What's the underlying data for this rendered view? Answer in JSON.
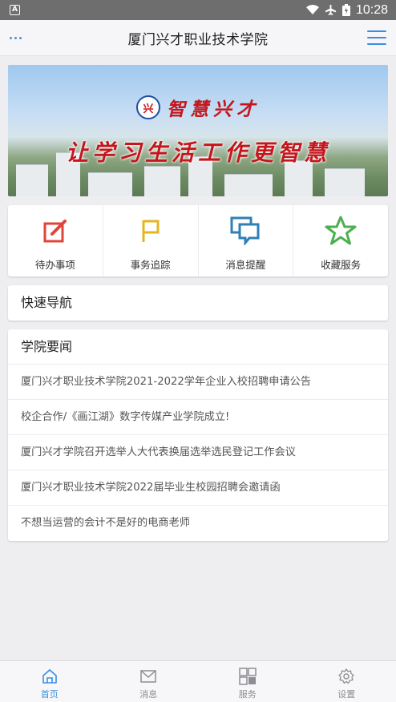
{
  "status_bar": {
    "time": "10:28",
    "app_icon_letter": "A"
  },
  "header": {
    "title": "厦门兴才职业技术学院"
  },
  "banner": {
    "brand": "智慧兴才",
    "slogan": "让学习生活工作更智慧",
    "emblem": "兴"
  },
  "quick_actions": [
    {
      "label": "待办事项",
      "icon": "edit-icon",
      "color": "#e0453a"
    },
    {
      "label": "事务追踪",
      "icon": "flag-icon",
      "color": "#e6b422"
    },
    {
      "label": "消息提醒",
      "icon": "chat-icon",
      "color": "#2f7fb8"
    },
    {
      "label": "收藏服务",
      "icon": "star-icon",
      "color": "#4caf50"
    }
  ],
  "quick_nav": {
    "title": "快速导航"
  },
  "news": {
    "title": "学院要闻",
    "items": [
      "厦门兴才职业技术学院2021-2022学年企业入校招聘申请公告",
      "校企合作/《画江湖》数字传媒产业学院成立!",
      "厦门兴才学院召开选举人大代表换届选举选民登记工作会议",
      "厦门兴才职业技术学院2022届毕业生校园招聘会邀请函",
      "不想当运营的会计不是好的电商老师"
    ]
  },
  "tabs": [
    {
      "label": "首页",
      "icon": "home-icon",
      "active": true
    },
    {
      "label": "消息",
      "icon": "mail-icon",
      "active": false
    },
    {
      "label": "服务",
      "icon": "grid-icon",
      "active": false
    },
    {
      "label": "设置",
      "icon": "gear-icon",
      "active": false
    }
  ],
  "colors": {
    "accent": "#3b8de0",
    "tab_inactive": "#8e8e93"
  }
}
